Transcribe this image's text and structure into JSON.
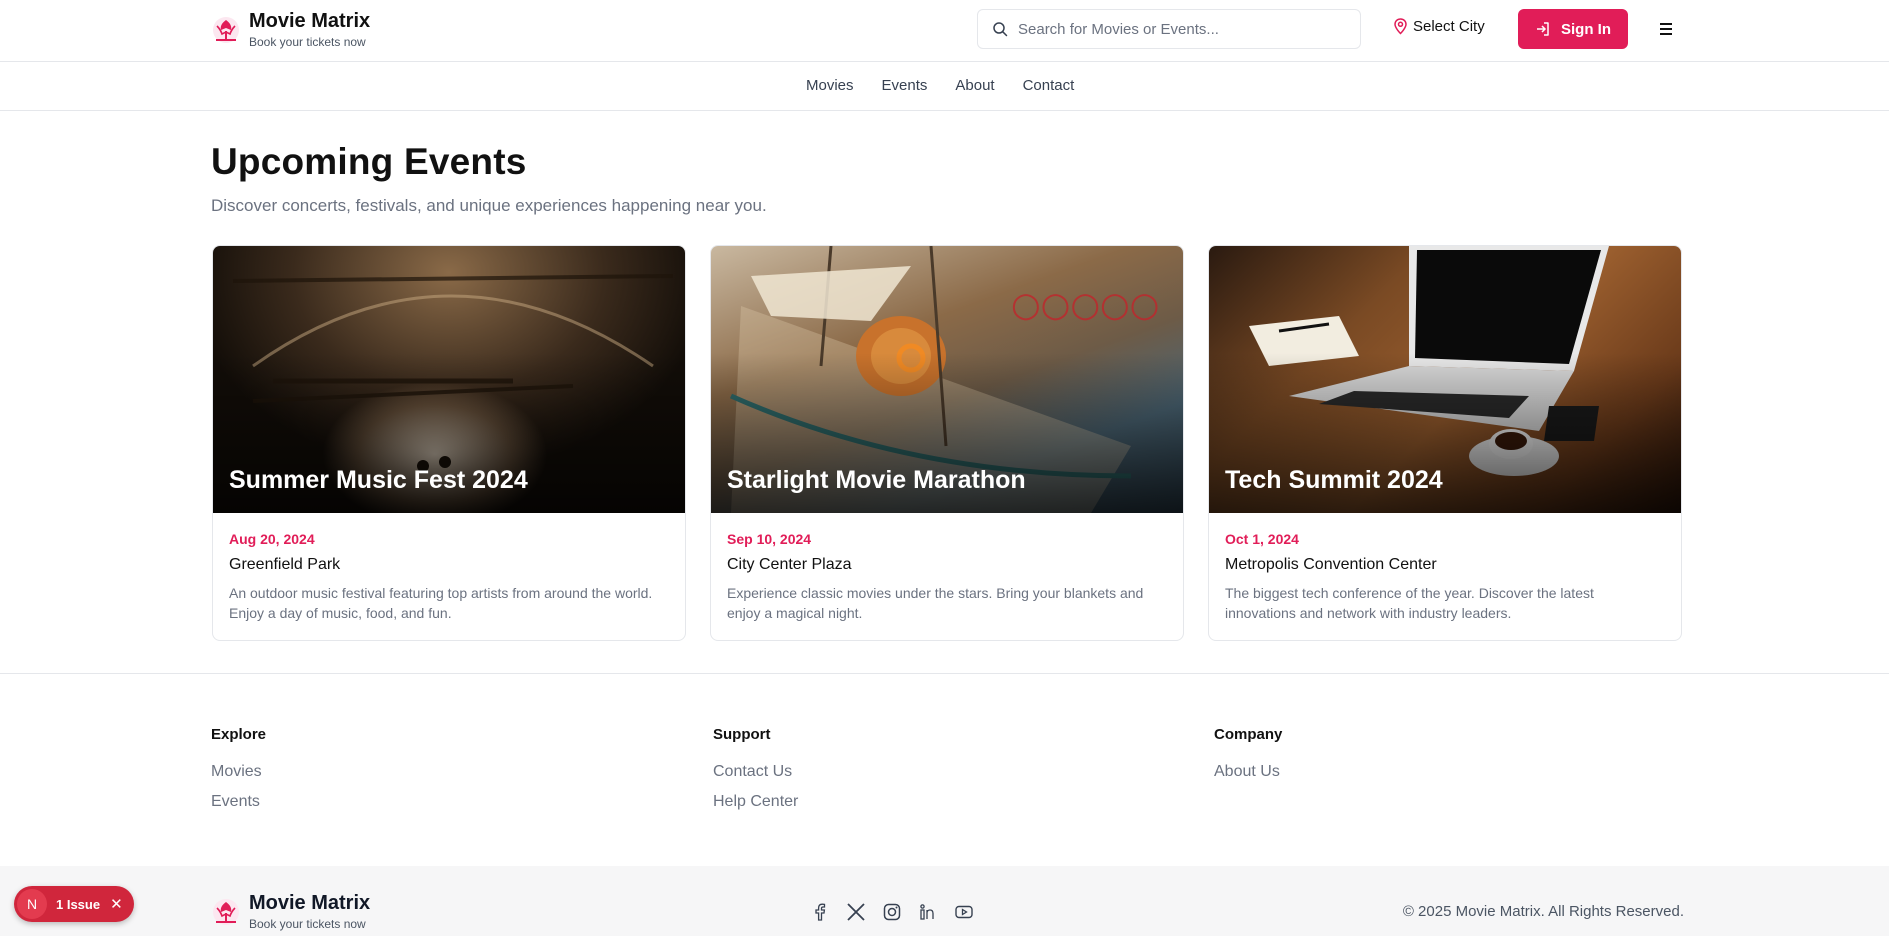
{
  "brand": {
    "name": "Movie Matrix",
    "tagline": "Book your tickets now"
  },
  "header": {
    "search_placeholder": "Search for Movies or Events...",
    "city_label": "Select City",
    "signin_label": "Sign In"
  },
  "nav": {
    "items": [
      {
        "label": "Movies"
      },
      {
        "label": "Events"
      },
      {
        "label": "About"
      },
      {
        "label": "Contact"
      }
    ]
  },
  "main": {
    "title": "Upcoming Events",
    "subtitle": "Discover concerts, festivals, and unique experiences happening near you."
  },
  "events": [
    {
      "name": "Summer Music Fest 2024",
      "date": "Aug 20, 2024",
      "venue": "Greenfield Park",
      "description": "An outdoor music festival featuring top artists from around the world. Enjoy a day of music, food, and fun."
    },
    {
      "name": "Starlight Movie Marathon",
      "date": "Sep 10, 2024",
      "venue": "City Center Plaza",
      "description": "Experience classic movies under the stars. Bring your blankets and enjoy a magical night."
    },
    {
      "name": "Tech Summit 2024",
      "date": "Oct 1, 2024",
      "venue": "Metropolis Convention Center",
      "description": "The biggest tech conference of the year. Discover the latest innovations and network with industry leaders."
    }
  ],
  "footer": {
    "columns": [
      {
        "heading": "Explore",
        "links": [
          {
            "label": "Movies"
          },
          {
            "label": "Events"
          }
        ]
      },
      {
        "heading": "Support",
        "links": [
          {
            "label": "Contact Us"
          },
          {
            "label": "Help Center"
          }
        ]
      },
      {
        "heading": "Company",
        "links": [
          {
            "label": "About Us"
          }
        ]
      }
    ],
    "socials": [
      "facebook-icon",
      "x-icon",
      "instagram-icon",
      "linkedin-icon",
      "youtube-icon"
    ],
    "copyright": "© 2025 Movie Matrix. All Rights Reserved."
  },
  "issue_badge": {
    "initial": "N",
    "label": "1 Issue"
  },
  "colors": {
    "accent": "#e11d58",
    "text": "#111827",
    "muted": "#6b7280"
  }
}
